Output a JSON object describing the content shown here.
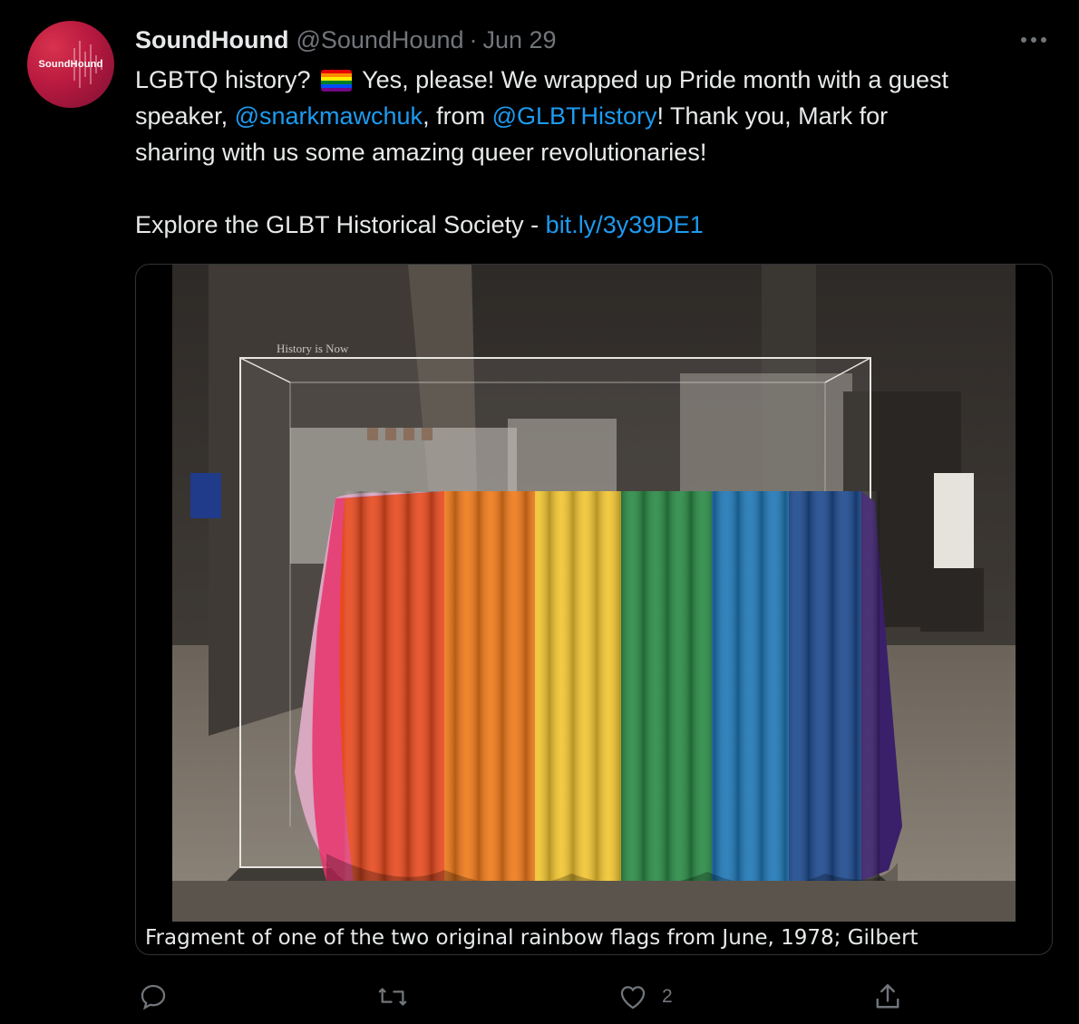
{
  "tweet": {
    "author_name": "SoundHound",
    "author_handle": "@SoundHound",
    "separator": "·",
    "date": "Jun 29",
    "avatar_text": "SoundHound",
    "more_icon": "ellipsis-icon",
    "text": {
      "l1_a": "LGBTQ history?",
      "l1_b": "Yes, please! We wrapped up Pride month with a guest",
      "l2_a": "speaker, ",
      "l2_mention1": "@snarkmawchuk",
      "l2_b": ", from ",
      "l2_mention2": "@GLBTHistory",
      "l2_c": "! Thank you, Mark for",
      "l3": "sharing with us some amazing queer revolutionaries!",
      "l5_a": "Explore the GLBT Historical Society - ",
      "l5_link": "bit.ly/3y39DE1"
    },
    "media": {
      "sign_text": "History is Now",
      "caption": "Fragment of one of the two original rainbow flags from June, 1978;  Gilbert"
    },
    "actions": {
      "reply_icon": "reply-icon",
      "retweet_icon": "retweet-icon",
      "like_icon": "heart-icon",
      "like_count": "2",
      "share_icon": "share-icon"
    }
  },
  "colors": {
    "background": "#000000",
    "text": "#e7e9ea",
    "muted": "#71767b",
    "link": "#1d9bf0",
    "avatar_red": "#c41e45"
  }
}
